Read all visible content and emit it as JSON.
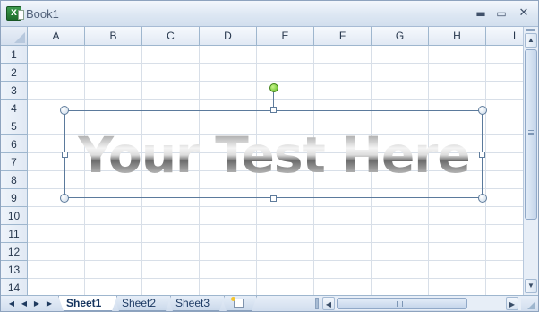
{
  "window": {
    "title": "Book1",
    "app_icon": "excel-icon",
    "app_icon_text": "X",
    "minimize_symbol": "▬",
    "maximize_symbol": "▭",
    "close_symbol": "✕"
  },
  "grid": {
    "columns": [
      "A",
      "B",
      "C",
      "D",
      "E",
      "F",
      "G",
      "H",
      "I"
    ],
    "rows": [
      "1",
      "2",
      "3",
      "4",
      "5",
      "6",
      "7",
      "8",
      "9",
      "10",
      "11",
      "12",
      "13",
      "14"
    ]
  },
  "wordart": {
    "text": "Your Test Here",
    "fill_style": "silver-gradient",
    "rotate_handle_color": "#7ad035",
    "selection_color": "#5b7a9c"
  },
  "sheet_tabs": [
    {
      "label": "Sheet1",
      "active": true
    },
    {
      "label": "Sheet2",
      "active": false
    },
    {
      "label": "Sheet3",
      "active": false
    }
  ],
  "tab_nav": {
    "first": "◀",
    "prev": "◀",
    "next": "▶",
    "last": "▶"
  },
  "scroll": {
    "up": "▲",
    "down": "▼",
    "left": "◀",
    "right": "▶"
  },
  "colors": {
    "title_bar": "#dde7f3",
    "header_fill": "#e1e9f4",
    "gridline": "#d8dfe8",
    "tab_text": "#1d3a63"
  }
}
